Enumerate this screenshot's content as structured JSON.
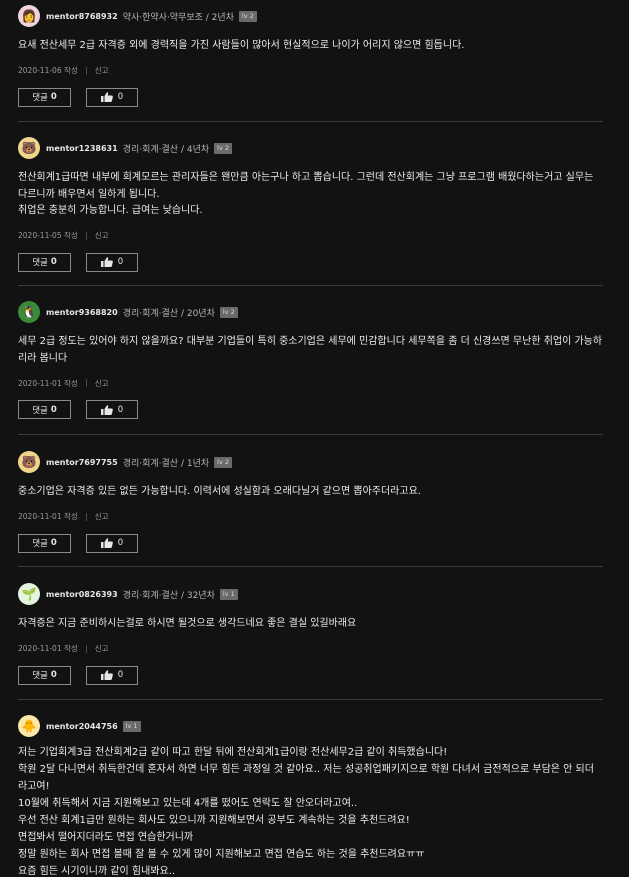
{
  "comments": [
    {
      "avatar_icon": "pink-character-icon",
      "avatar_emoji": "👩",
      "avatar_bg": "#f3d3db",
      "username": "mentor8768932",
      "meta": "약사·한약사·약무보조 / 2년차",
      "level": "lv 2",
      "body": "요새 전산세무 2급 자격증 외에 경력직을 가진 사람들이 많아서 현실적으로 나이가 어리지 않으면 힘듭니다.",
      "date": "2020-11-06 작성",
      "report": "신고",
      "reply_label": "댓글",
      "reply_count": "0",
      "like_count": "0"
    },
    {
      "avatar_icon": "bear-icon",
      "avatar_emoji": "🐻",
      "avatar_bg": "#f1d58a",
      "username": "mentor1238631",
      "meta": "경리·회계·결산 / 4년차",
      "level": "lv 2",
      "body": "전산회계1급따면 내부에 회계모르는 관리자들은 왠만큼 아는구나 하고 뽑습니다. 그런데 전산회계는 그냥 프로그램 배웠다하는거고 실무는 다르니까 배우면서 일하게 됩니다.\n취업은 충분히 가능합니다. 급여는 낮습니다.",
      "date": "2020-11-05 작성",
      "report": "신고",
      "reply_label": "댓글",
      "reply_count": "0",
      "like_count": "0"
    },
    {
      "avatar_icon": "penguin-icon",
      "avatar_emoji": "🐧",
      "avatar_bg": "#3a8a3a",
      "username": "mentor9368820",
      "meta": "경리·회계·결산 / 20년차",
      "level": "lv 2",
      "body": "세무 2급 정도는 있어야 하지 않을까요? 대부분 기업들이 특히 중소기업은 세무에 민감합니다 세무쪽을 좀 더 신경쓰면 무난한 취업이 가능하리라 봅니다",
      "date": "2020-11-01 작성",
      "report": "신고",
      "reply_label": "댓글",
      "reply_count": "0",
      "like_count": "0"
    },
    {
      "avatar_icon": "bear-icon",
      "avatar_emoji": "🐻",
      "avatar_bg": "#f1d58a",
      "username": "mentor7697755",
      "meta": "경리·회계·결산 / 1년차",
      "level": "lv 2",
      "body": "중소기업은 자격증 있든 없든 가능합니다. 이력서에 성실함과 오래다닐거 같으면 뽑아주더라고요.",
      "date": "2020-11-01 작성",
      "report": "신고",
      "reply_label": "댓글",
      "reply_count": "0",
      "like_count": "0"
    },
    {
      "avatar_icon": "sprout-icon",
      "avatar_emoji": "🌱",
      "avatar_bg": "#e3f5df",
      "username": "mentor0826393",
      "meta": "경리·회계·결산 / 32년차",
      "level": "lv 1",
      "body": "자격증은 지금 준비하시는걸로 하시면 될것으로 생각드네요 좋은 결실 있길바래요",
      "date": "2020-11-01 작성",
      "report": "신고",
      "reply_label": "댓글",
      "reply_count": "0",
      "like_count": "0"
    },
    {
      "avatar_icon": "chick-icon",
      "avatar_emoji": "🐥",
      "avatar_bg": "#fbe8a6",
      "username": "mentor2044756",
      "meta": "",
      "level": "lv 1",
      "body": "저는 기업회계3급 전산회계2급 같이 따고 한달 뒤에 전산회계1급이랑 전산세무2급 같이 취득했습니다!\n학원 2달 다니면서 취득한건데 혼자서 하면 너무 힘든 과정일 것 같아요.. 저는 성공취업패키지으로 학원 다녀서 금전적으로 부담은 안 되더라고여!\n10월에 취득해서 지금 지원해보고 있는데 4개를 떴어도 연락도 잘 안오더라고여..\n우선 전산 회계1급만 원하는 회사도 있으니까 지원해보면서 공부도 계속하는 것을 추천드려요!\n면접봐서 떨어지더라도 면접 연습한거니까\n정말 원하는 회사 면접 볼때 잘 볼 수 있게 많이 지원해보고 면접 연습도 하는 것을 추천드려요ㅠㅠ\n요즘 힘든 시기이니까 같이 힘내봐요..",
      "date": "",
      "report": "",
      "reply_label": "",
      "reply_count": "",
      "like_count": ""
    }
  ]
}
